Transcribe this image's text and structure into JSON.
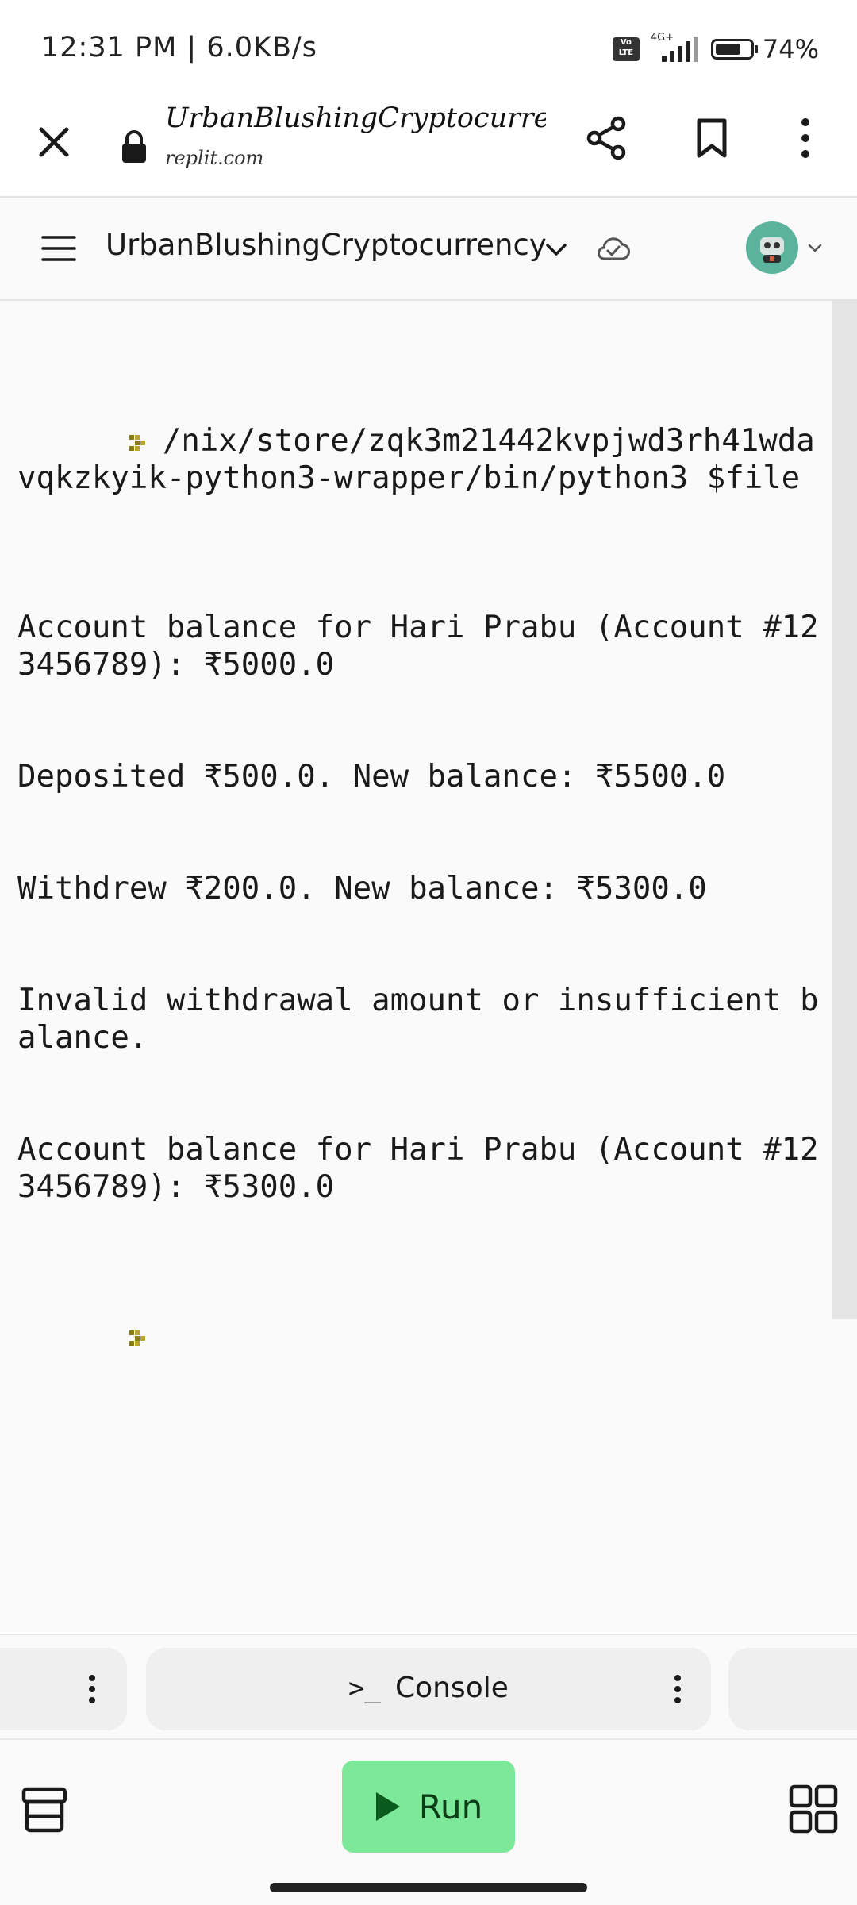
{
  "status_bar": {
    "time": "12:31 PM | 6.0KB/s",
    "volte": "Vo\nLTE",
    "network": "4G+",
    "battery_percent": "74%",
    "battery_level": 0.74
  },
  "browser": {
    "title": "UrbanBlushingCryptocurren…",
    "domain": "replit.com"
  },
  "repl_header": {
    "name": "UrbanBlushingCryptocurrency"
  },
  "console": {
    "lines": [
      "/nix/store/zqk3m21442kvpjwd3rh41wdavqkzkyik-python3-wrapper/bin/python3 $file",
      "Account balance for Hari Prabu (Account #123456789): ₹5000.0",
      "Deposited ₹500.0. New balance: ₹5500.0",
      "Withdrew ₹200.0. New balance: ₹5300.0",
      "Invalid withdrawal amount or insufficient balance.",
      "Account balance for Hari Prabu (Account #123456789): ₹5300.0"
    ]
  },
  "tabs": {
    "console_icon": ">_",
    "console_label": "Console"
  },
  "bottom_bar": {
    "run_label": "Run"
  },
  "colors": {
    "run_button": "#7ee89a",
    "prompt": "#8a7a10",
    "avatar": "#5bb39e"
  }
}
